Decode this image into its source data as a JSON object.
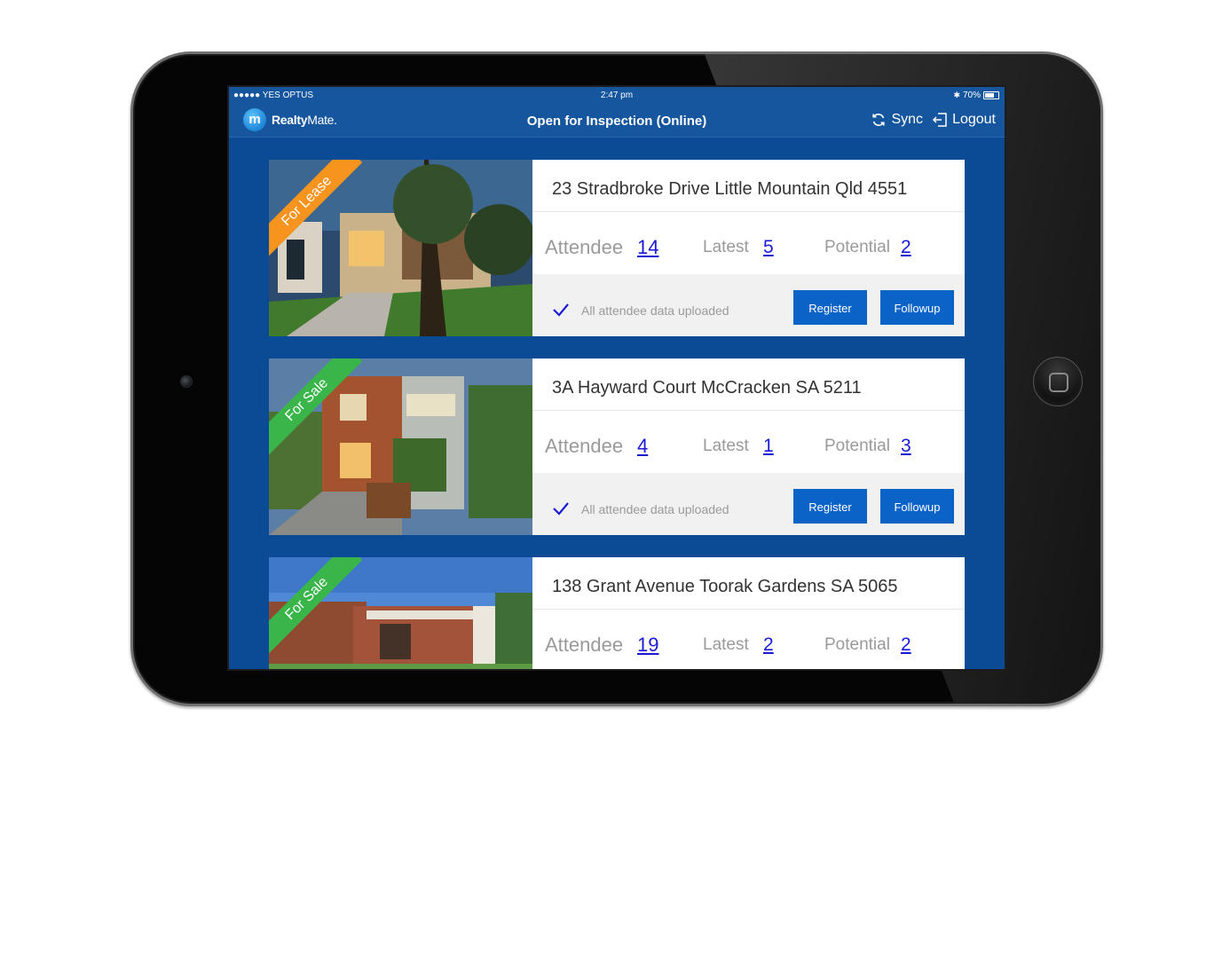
{
  "status_bar": {
    "carrier": "●●●●● YES OPTUS",
    "time": "2:47 pm",
    "battery": "70%",
    "battery_level": 0.7
  },
  "header": {
    "logo_letter": "m",
    "logo_bold": "Realty",
    "logo_light": "Mate.",
    "title": "Open for Inspection (Online)",
    "sync_label": "Sync",
    "logout_label": "Logout"
  },
  "stat_labels": {
    "attendee": "Attendee",
    "latest": "Latest",
    "potential": "Potential"
  },
  "listings": [
    {
      "ribbon": "For Lease",
      "ribbon_color": "#f7941d",
      "address": "23 Stradbroke Drive Little Mountain Qld 4551",
      "attendee": "14",
      "latest": "5",
      "potential": "2",
      "upload_status": "All attendee data uploaded",
      "register_label": "Register",
      "followup_label": "Followup"
    },
    {
      "ribbon": "For Sale",
      "ribbon_color": "#39b54a",
      "address": "3A Hayward Court McCracken SA 5211",
      "attendee": "4",
      "latest": "1",
      "potential": "3",
      "upload_status": "All attendee data uploaded",
      "register_label": "Register",
      "followup_label": "Followup"
    },
    {
      "ribbon": "For Sale",
      "ribbon_color": "#39b54a",
      "address": "138 Grant Avenue Toorak Gardens SA 5065",
      "attendee": "19",
      "latest": "2",
      "potential": "2"
    }
  ],
  "colors": {
    "screen_background": "#0b4a94",
    "header_background": "#15569f",
    "button": "#0b62c7",
    "link": "#1a1ad6"
  }
}
